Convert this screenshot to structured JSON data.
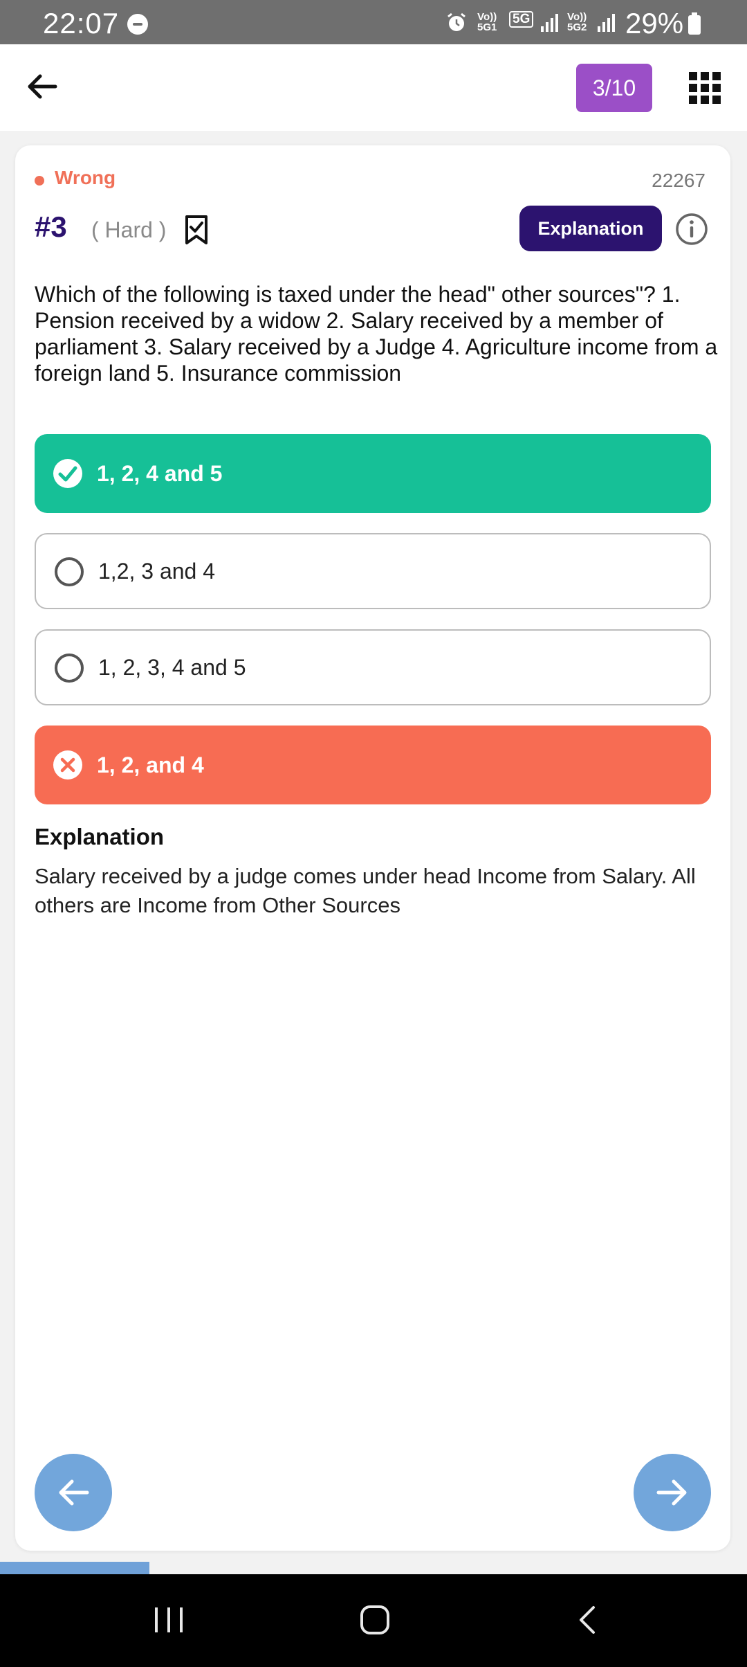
{
  "status_bar": {
    "time": "22:07",
    "net1": "Vo))\n5G1",
    "badge": "5G",
    "net2": "Vo))\n5G2",
    "battery": "29%"
  },
  "header": {
    "progress": "3/10"
  },
  "question": {
    "result": "Wrong",
    "id": "22267",
    "number": "#3",
    "difficulty": "( Hard )",
    "explanation_button": "Explanation",
    "text": "Which of the following is taxed under the head\" other sources\"? 1. Pension received by a widow 2. Salary received by a member of parliament 3. Salary received by a Judge 4. Agriculture income from a foreign land 5. Insurance commission",
    "options": [
      {
        "label": "1, 2,  4  and 5",
        "state": "correct"
      },
      {
        "label": "1,2, 3 and 4",
        "state": "neutral"
      },
      {
        "label": "1, 2, 3, 4  and 5",
        "state": "neutral"
      },
      {
        "label": "1, 2, and 4",
        "state": "wrong"
      }
    ]
  },
  "explanation": {
    "title": "Explanation",
    "body": "Salary received by a judge comes under head Income from Salary. All others are Income from Other Sources"
  },
  "quiz_progress": 0.2,
  "colors": {
    "correct": "#16c097",
    "wrong": "#f76c53",
    "primary": "#2c136f",
    "pill": "#9b4fc7",
    "nav_button": "#72a6db"
  }
}
